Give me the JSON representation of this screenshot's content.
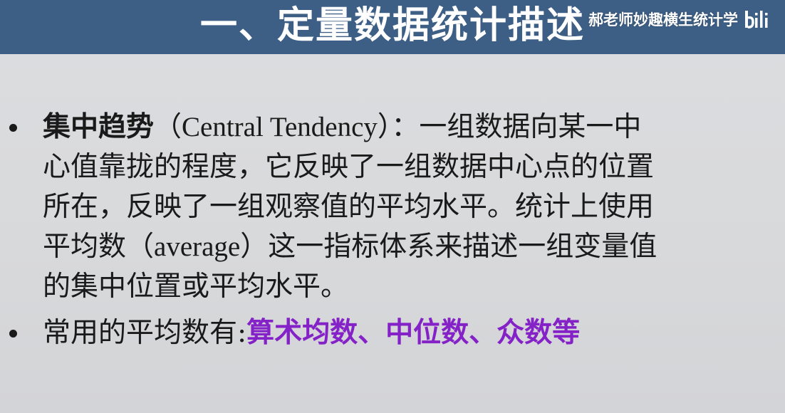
{
  "header": {
    "title": "一、定量数据统计描述",
    "watermark_text": "郝老师妙趣横生统计学",
    "watermark_logo": "bili"
  },
  "bullets": {
    "first": {
      "term": "集中趋势",
      "term_en": "（Central Tendency）",
      "line1_tail": "：一组数据向某一中",
      "line2": "心值靠拢的程度，它反映了一组数据中心点的位置",
      "line3": "所在，反映了一组观察值的平均水平。统计上使用",
      "line4_head": "平均数",
      "line4_en": "（average）",
      "line4_tail": "这一指标体系来描述一组变量值",
      "line5": "的集中位置或平均水平。"
    },
    "second": {
      "prefix": "常用的平均数有:",
      "highlight": "算术均数、中位数、众数等"
    }
  },
  "colors": {
    "header_bg": "#3d5f86",
    "highlight": "#8522c7"
  }
}
